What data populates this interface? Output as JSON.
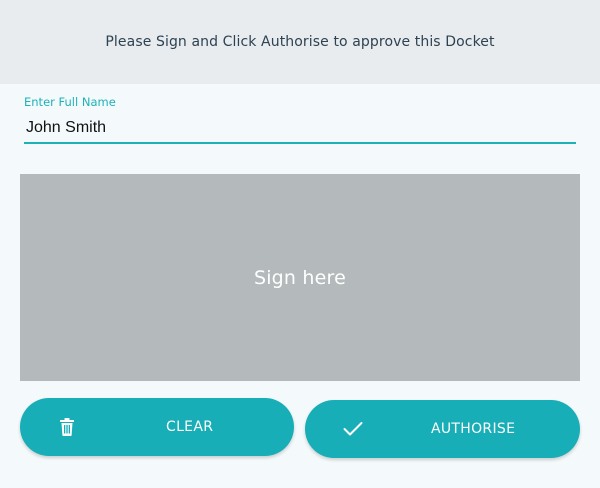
{
  "header": {
    "instruction": "Please Sign and Click Authorise to approve this Docket"
  },
  "name_field": {
    "label": "Enter Full Name",
    "value": "John Smith"
  },
  "signature_pad": {
    "placeholder": "Sign here"
  },
  "actions": {
    "clear_label": "CLEAR",
    "clear_icon": "trash-icon",
    "authorise_label": "AUTHORISE",
    "authorise_icon": "checkmark-icon"
  },
  "colors": {
    "accent": "#17aeb7",
    "header_bg": "#e8ecee",
    "pad_bg": "#b4b9bb",
    "header_text": "#2d4252"
  }
}
